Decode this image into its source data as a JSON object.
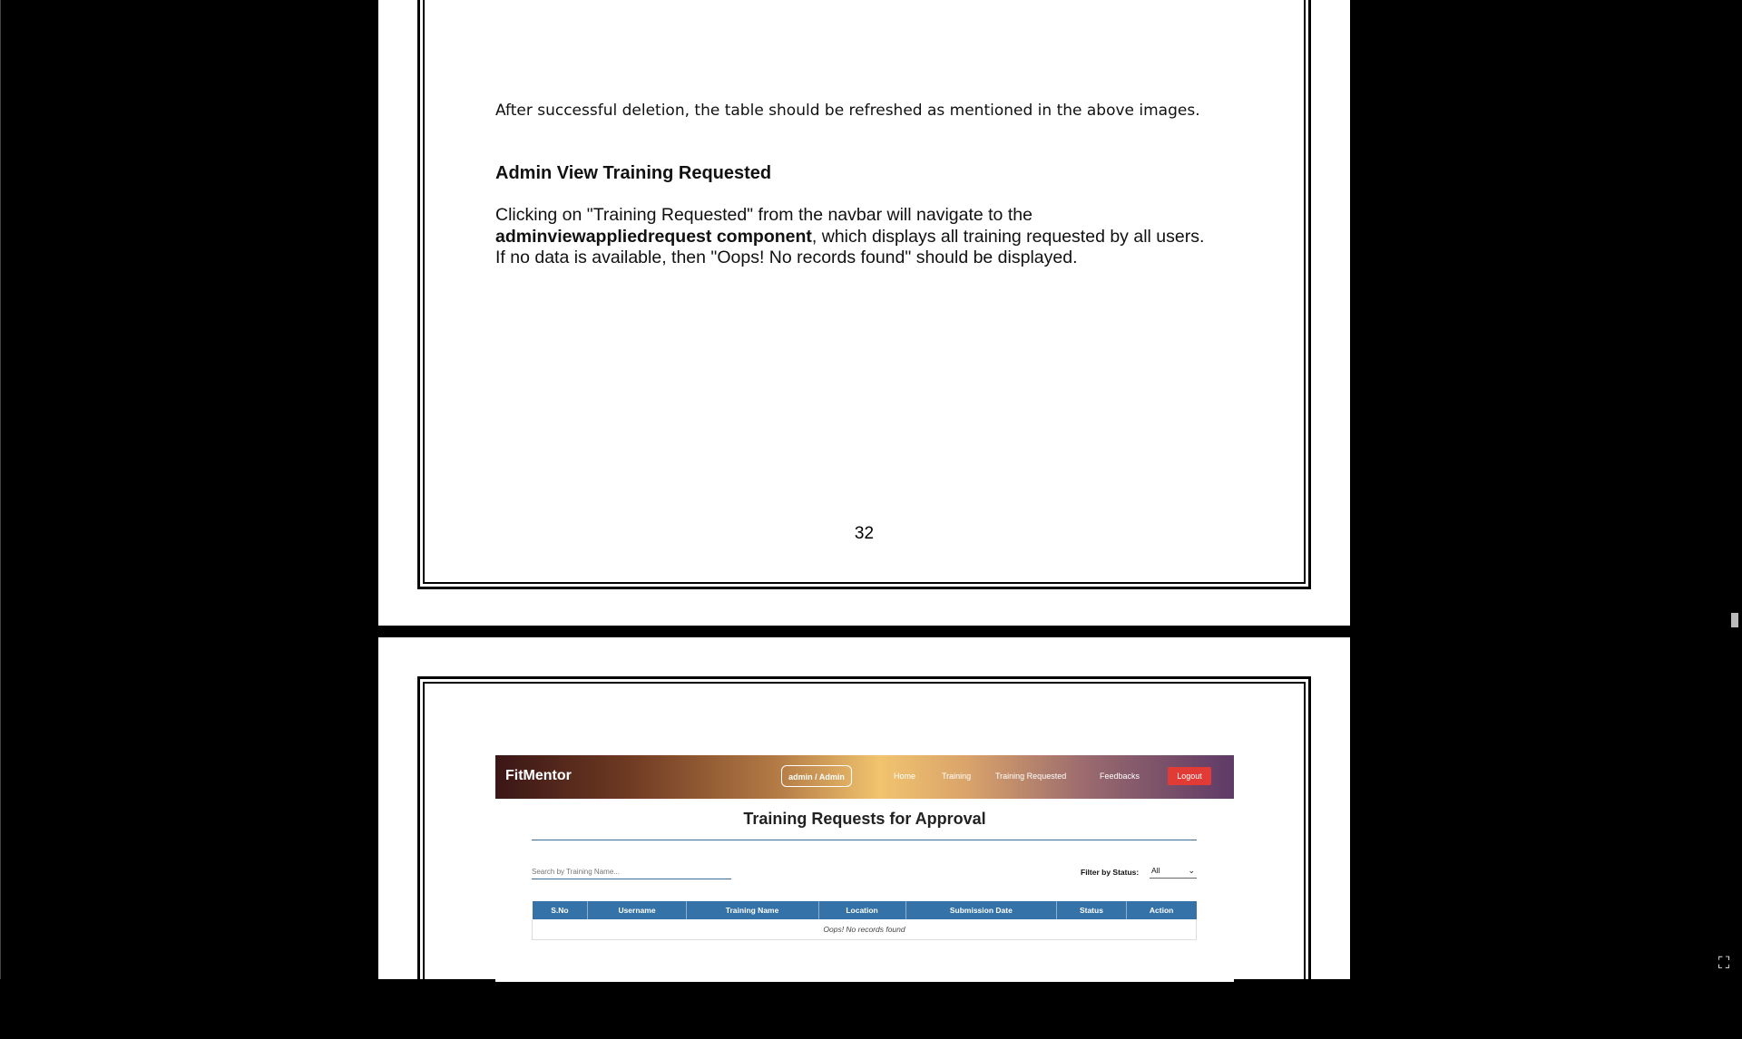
{
  "page1": {
    "note": "After successful deletion, the table should be refreshed as mentioned in the above images.",
    "heading": "Admin View Training Requested",
    "para_line1": "Clicking on \"Training Requested\" from the navbar will navigate to the",
    "para_bold": "adminviewappliedrequest component",
    "para_line2_rest": ", which displays all training requested by all users.",
    "para_line3": "If no data is available, then \"Oops! No records found\" should be displayed.",
    "page_number": "32"
  },
  "screenshot": {
    "brand": "FitMentor",
    "role": "admin / Admin",
    "nav": [
      "Home",
      "Training",
      "Training Requested",
      "Feedbacks"
    ],
    "logout": "Logout",
    "title": "Training Requests for Approval",
    "search_placeholder": "Search by Training Name...",
    "filter_label": "Filter by Status:",
    "filter_value": "All",
    "columns": [
      "S.No",
      "Username",
      "Training Name",
      "Location",
      "Submission Date",
      "Status",
      "Action"
    ],
    "empty_message": "Oops! No records found",
    "colors": {
      "table_header": "#3572a8",
      "logout": "#e23a35"
    }
  },
  "viewer": {
    "fullscreen_icon": "exit-fullscreen-icon"
  }
}
